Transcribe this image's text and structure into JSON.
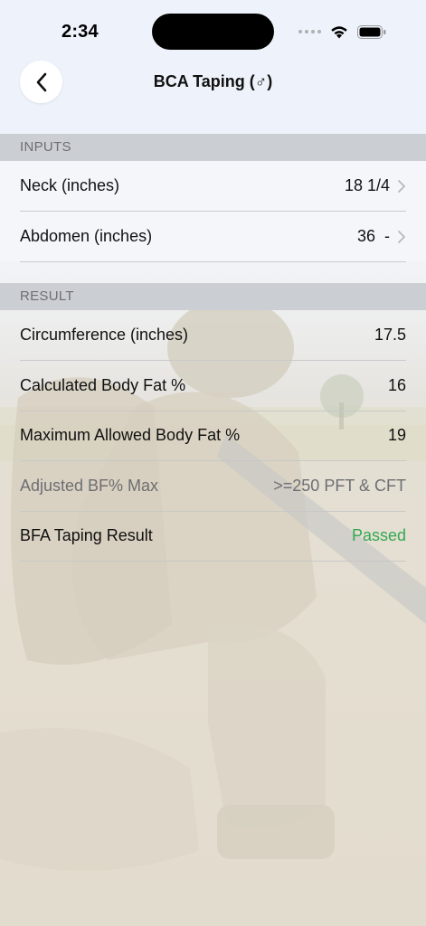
{
  "status_bar": {
    "time": "2:34"
  },
  "nav": {
    "title": "BCA Taping (♂)"
  },
  "inputs": {
    "header": "INPUTS",
    "rows": [
      {
        "label": "Neck (inches)",
        "value": "18 1/4"
      },
      {
        "label": "Abdomen (inches)",
        "value": "36  -"
      }
    ]
  },
  "result": {
    "header": "RESULT",
    "rows": [
      {
        "label": "Circumference (inches)",
        "value": "17.5"
      },
      {
        "label": "Calculated Body Fat %",
        "value": "16"
      },
      {
        "label": "Maximum Allowed Body Fat %",
        "value": "19"
      },
      {
        "label": "Adjusted BF% Max",
        "value": ">=250 PFT & CFT"
      },
      {
        "label": "BFA Taping Result",
        "value": "Passed"
      }
    ]
  },
  "colors": {
    "passed": "#34a853",
    "section_header_bg": "#cbced3"
  },
  "icons": {
    "back": "chevron-left-icon",
    "row_disclosure": "chevron-right-icon",
    "wifi": "wifi-icon",
    "battery": "battery-icon",
    "cellular": "cellular-signal-icon"
  }
}
